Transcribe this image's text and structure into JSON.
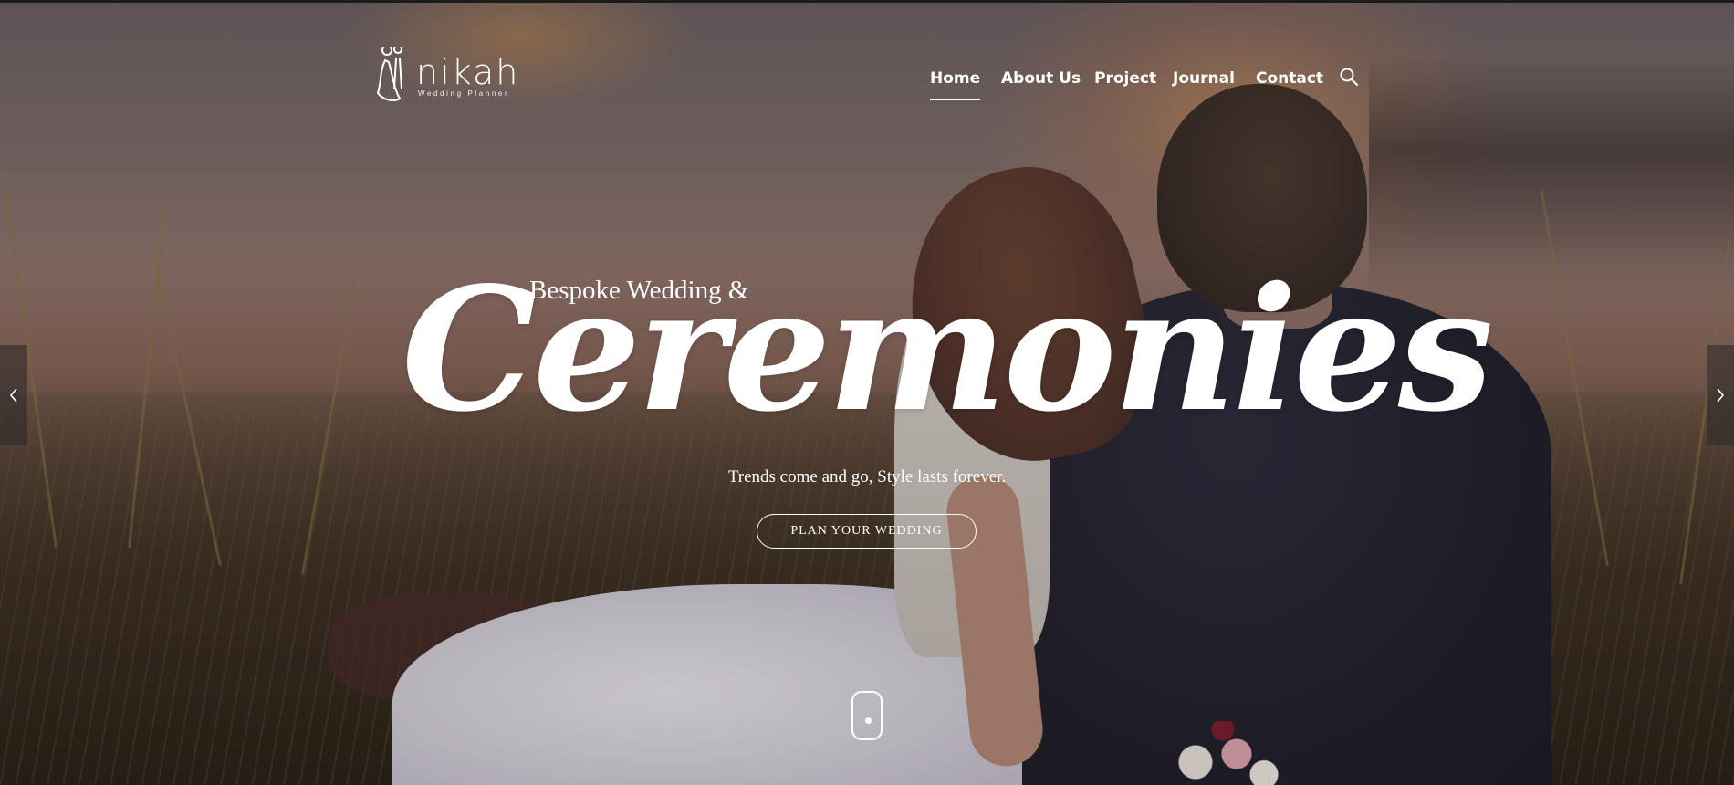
{
  "brand": {
    "name": "nikah",
    "tagline": "Wedding Planner"
  },
  "nav": {
    "items": [
      {
        "label": "Home",
        "active": true
      },
      {
        "label": "About Us",
        "active": false
      },
      {
        "label": "Project",
        "active": false
      },
      {
        "label": "Journal",
        "active": false
      },
      {
        "label": "Contact",
        "active": false
      }
    ],
    "search_icon": "search-icon"
  },
  "hero": {
    "pretitle": "Bespoke Wedding &",
    "title": "Ceremonies",
    "subtitle": "Trends come and go, Style lasts forever.",
    "cta_label": "PLAN YOUR WEDDING"
  },
  "slider": {
    "prev_icon": "chevron-left-icon",
    "next_icon": "chevron-right-icon",
    "scroll_icon": "mouse-scroll-icon"
  },
  "colors": {
    "text": "#ffffff",
    "arrow_bg": "#282828"
  }
}
